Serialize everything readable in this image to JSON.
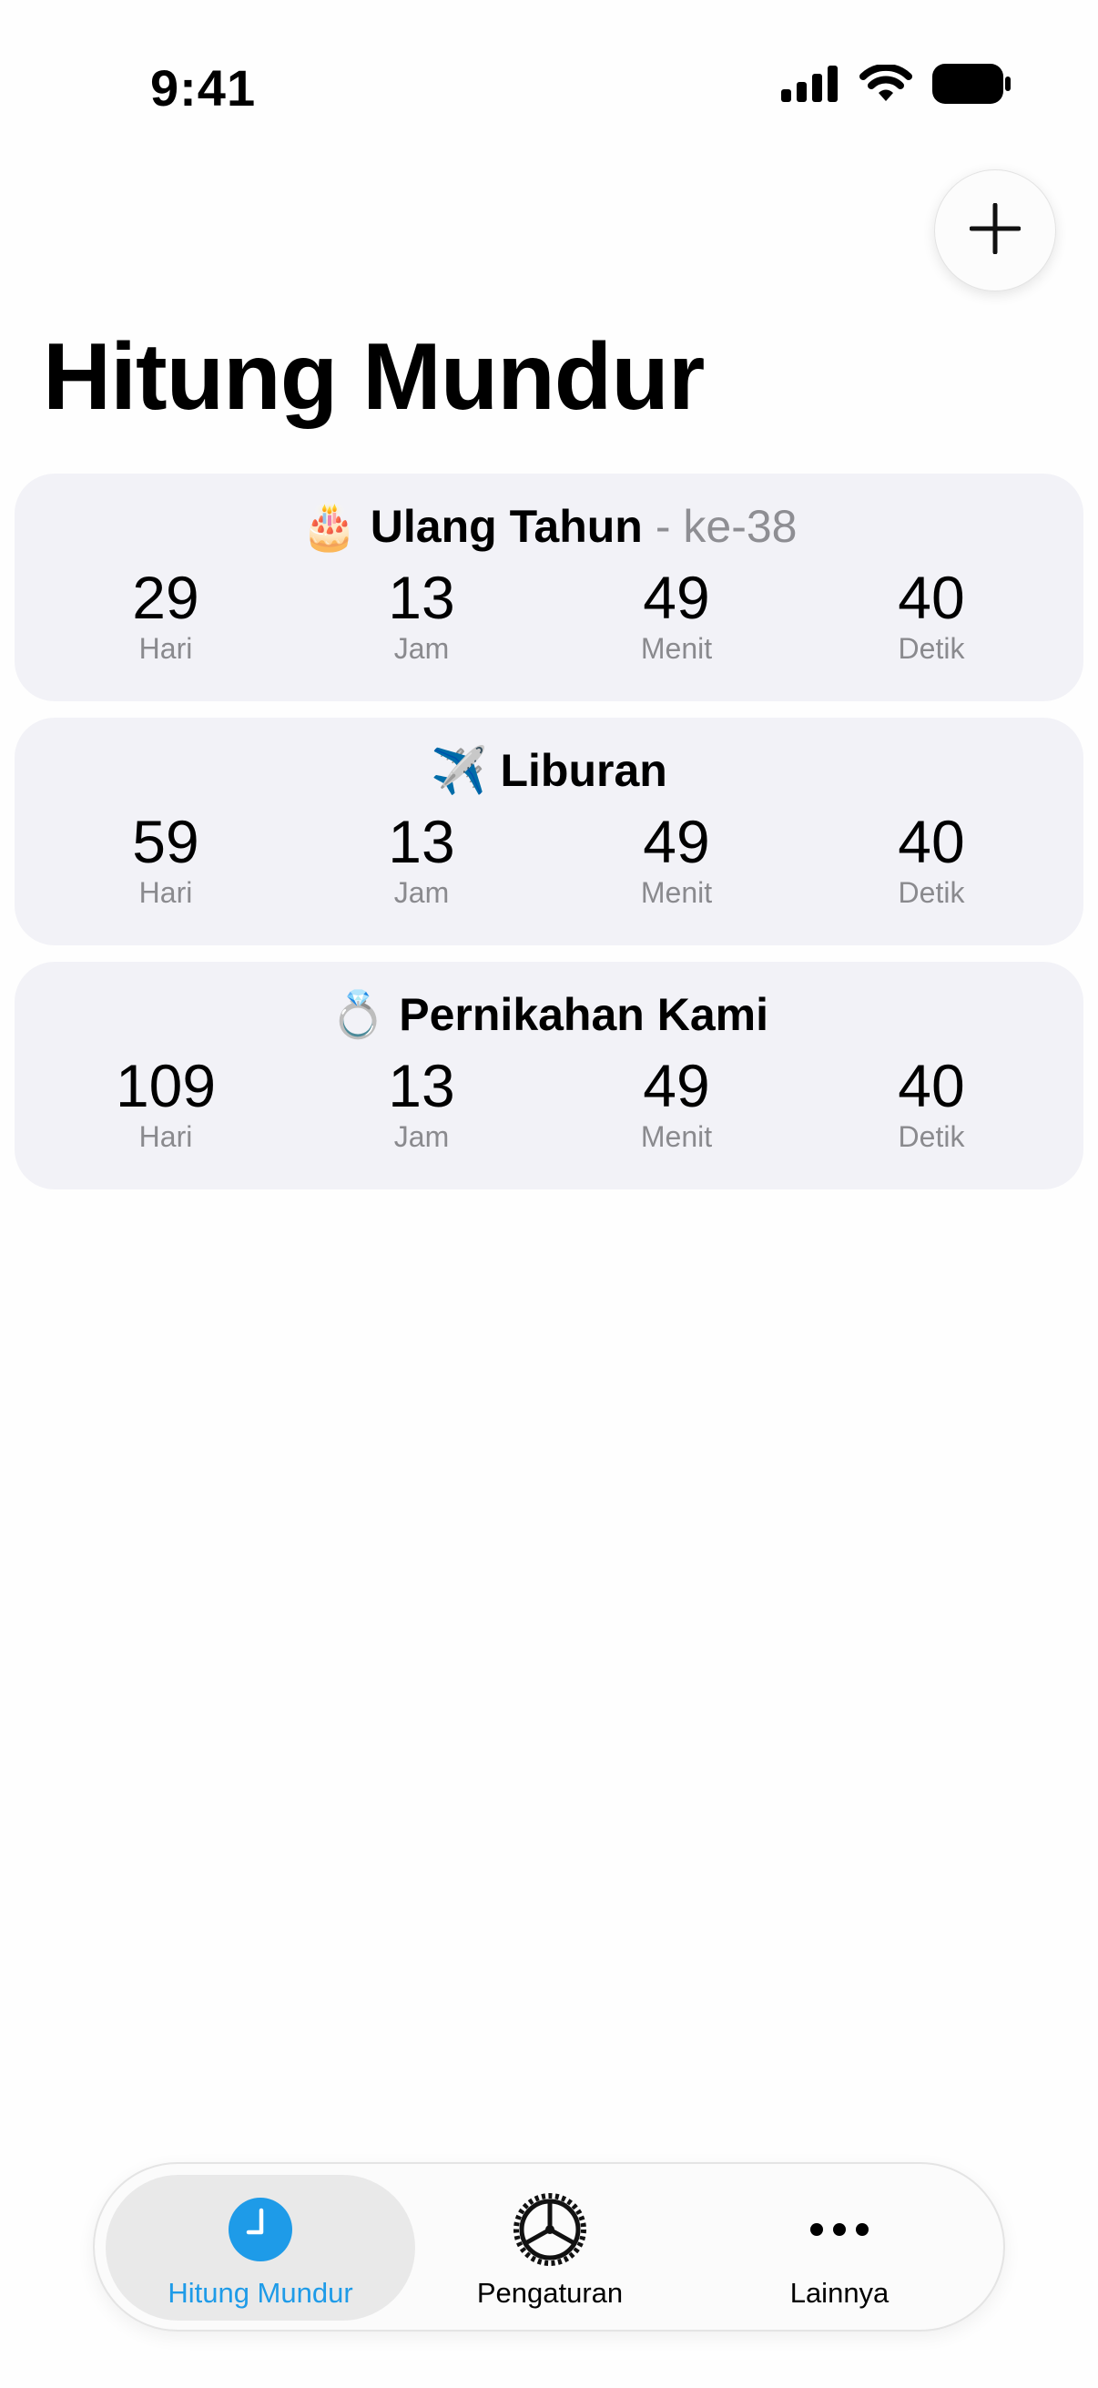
{
  "status_bar": {
    "time": "9:41",
    "icons": [
      "cellular-signal-icon",
      "wifi-icon",
      "battery-icon"
    ]
  },
  "add_button": {
    "icon": "plus-icon"
  },
  "page_title": "Hitung Mundur",
  "countdowns": [
    {
      "emoji": "🎂",
      "title": "Ulang Tahun",
      "suffix": "- ke-38",
      "units": [
        {
          "value": "29",
          "label": "Hari"
        },
        {
          "value": "13",
          "label": "Jam"
        },
        {
          "value": "49",
          "label": "Menit"
        },
        {
          "value": "40",
          "label": "Detik"
        }
      ]
    },
    {
      "emoji": "✈️",
      "title": "Liburan",
      "suffix": "",
      "units": [
        {
          "value": "59",
          "label": "Hari"
        },
        {
          "value": "13",
          "label": "Jam"
        },
        {
          "value": "49",
          "label": "Menit"
        },
        {
          "value": "40",
          "label": "Detik"
        }
      ]
    },
    {
      "emoji": "💍",
      "title": "Pernikahan Kami",
      "suffix": "",
      "units": [
        {
          "value": "109",
          "label": "Hari"
        },
        {
          "value": "13",
          "label": "Jam"
        },
        {
          "value": "49",
          "label": "Menit"
        },
        {
          "value": "40",
          "label": "Detik"
        }
      ]
    }
  ],
  "tab_bar": {
    "items": [
      {
        "label": "Hitung Mundur",
        "icon": "clock-icon",
        "active": true
      },
      {
        "label": "Pengaturan",
        "icon": "gear-icon",
        "active": false
      },
      {
        "label": "Lainnya",
        "icon": "more-icon",
        "active": false
      }
    ]
  },
  "colors": {
    "accent": "#1E9BE8",
    "card_background": "#F2F2F7",
    "secondary_text": "#8E8E93"
  }
}
